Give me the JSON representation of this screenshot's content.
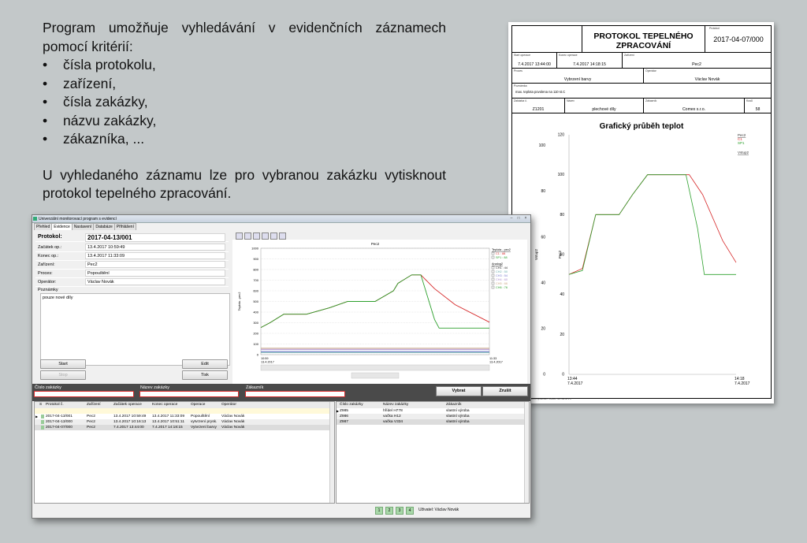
{
  "intro": {
    "para1": "Program umožňuje vyhledávání v evidenčních záznamech pomocí kritérií:",
    "bullets": [
      "čísla protokolu,",
      "zařízení,",
      "čísla zakázky,",
      "názvu zakázky,",
      "zákazníka, ..."
    ],
    "para2": "U vyhledaného záznamu lze pro vybranou zakázku vytisknout protokol tepelného zpracování."
  },
  "report": {
    "title": "PROTOKOL TEPELNÉHO ZPRACOVÁNÍ",
    "number_label": "Protokol",
    "number": "2017-04-07/000",
    "start_label": "Start operace",
    "start": "7.4.2017 13:44:00",
    "end_label": "Konec operace",
    "end": "7.4.2017 14:18:15",
    "device_label": "Zařízení",
    "device": "Pec2",
    "process_label": "Proces",
    "process": "Vybrzení barvy",
    "operator_label": "Operátor",
    "operator": "Václav Novák",
    "notes_label": "Poznámka",
    "notes": "max. teplota povolena na 110 st.C",
    "order_no_label": "Zakázka č.",
    "order_no": "Z1201",
    "order_name_label": "Název",
    "order_name": "plechové díly",
    "customer_label": "Zákazník",
    "customer": "Comex s.r.o.",
    "qty_label": "Kusů",
    "qty": "58",
    "chart_title": "Grafický průběh teplot",
    "footer": "Vytvořeno systémem ToBoxIT EV verze 1.0"
  },
  "app": {
    "window_title": "Univerzální monitorovací program s evidencí",
    "tabs": [
      "Přehled",
      "Evidence",
      "Nastavení",
      "Databáze",
      "Přihlášení"
    ],
    "fields": [
      {
        "label": "Protokol:",
        "value": "2017-04-13/001"
      },
      {
        "label": "Začátek op.:",
        "value": "13.4.2017 10:59:49"
      },
      {
        "label": "Konec op.:",
        "value": "13.4.2017 11:33:09"
      },
      {
        "label": "Zařízení:",
        "value": "Pec2"
      },
      {
        "label": "Proces:",
        "value": "Popouštění"
      },
      {
        "label": "Operátor:",
        "value": "Václav Novák"
      }
    ],
    "notes_label": "Poznámky",
    "notes": "pouze nové díly",
    "buttons": {
      "start": "Start",
      "stop": "Stop",
      "edit": "Edit",
      "print": "Tisk"
    },
    "chart_title": "Pec2",
    "search": {
      "order_no_label": "Číslo zakázky",
      "order_name_label": "Název zakázky",
      "customer_label": "Zákazník",
      "select_button": "Vybrat",
      "clear_button": "Zrušit"
    },
    "protocols": {
      "headers": [
        "S",
        "Protokol č.",
        "Zařízení",
        "Začátek operace",
        "Konec operace",
        "Operace",
        "Operátor"
      ],
      "rows": [
        [
          "",
          "2017-04-13/001",
          "Pec2",
          "13.4.2017 10:59:49",
          "13.4.2017 11:33:09",
          "Popouštění",
          "Václav Novák"
        ],
        [
          "",
          "2017-04-13/000",
          "Pec2",
          "13.4.2017 10:16:13",
          "13.4.2017 10:51:11",
          "vytvrzení prysk.",
          "Václav Novák"
        ],
        [
          "",
          "2017-04-07/000",
          "Pec2",
          "7.4.2017 13:44:00",
          "7.4.2017 14:18:15",
          "Vytvrzení barvy",
          "Václav Novák"
        ]
      ]
    },
    "orders": {
      "headers": [
        "Číslo zakázky",
        "Název zakázky",
        "Zákazník"
      ],
      "rows": [
        [
          "Z985",
          "hřídel H778",
          "vlastní výroba"
        ],
        [
          "Z986",
          "vačka H12",
          "vlastní výroba"
        ],
        [
          "Z987",
          "vačka V334",
          "vlastní výroba"
        ]
      ]
    },
    "pages": [
      "1",
      "2",
      "3",
      "4"
    ],
    "user": "Uživatel: Václav Novák"
  },
  "chart_data": [
    {
      "type": "line",
      "title": "Pec2",
      "xlabel": "",
      "ylabel": "Teplota - pec2",
      "x": [
        "10:59 13.4.2017",
        "11:33 13.4.2017"
      ],
      "ylim": [
        0,
        1000
      ],
      "yticks": [
        0,
        100,
        200,
        300,
        400,
        500,
        600,
        700,
        800,
        900,
        1000
      ],
      "x_tick_labels": [
        {
          "time": "10:59",
          "date": "13.4.2017"
        },
        {
          "time": "11:33",
          "date": "13.4.2017"
        }
      ],
      "legend": {
        "group1_title": "Teplota - pec2",
        "group1": [
          "C1 : 88",
          "SP1 : 88"
        ],
        "group2_title": "Analog2",
        "group2": [
          "CH1 : 44",
          "CH2 : 50",
          "CH3 : 54",
          "CH4 : 60",
          "CH5 : 66",
          "CH6 : 76"
        ]
      },
      "series": [
        {
          "name": "C1",
          "color": "#d62728",
          "points": [
            [
              0,
              255
            ],
            [
              0.04,
              300
            ],
            [
              0.1,
              380
            ],
            [
              0.2,
              380
            ],
            [
              0.3,
              440
            ],
            [
              0.38,
              500
            ],
            [
              0.5,
              500
            ],
            [
              0.58,
              600
            ],
            [
              0.6,
              670
            ],
            [
              0.66,
              750
            ],
            [
              0.7,
              750
            ],
            [
              0.76,
              620
            ],
            [
              0.85,
              470
            ],
            [
              1,
              305
            ]
          ]
        },
        {
          "name": "SP1",
          "color": "#2ca02c",
          "points": [
            [
              0,
              255
            ],
            [
              0.04,
              300
            ],
            [
              0.1,
              380
            ],
            [
              0.2,
              380
            ],
            [
              0.3,
              440
            ],
            [
              0.38,
              500
            ],
            [
              0.5,
              500
            ],
            [
              0.58,
              600
            ],
            [
              0.6,
              670
            ],
            [
              0.66,
              750
            ],
            [
              0.7,
              750
            ],
            [
              0.76,
              330
            ],
            [
              0.78,
              250
            ],
            [
              1,
              250
            ]
          ]
        }
      ],
      "flat_lines": [
        {
          "color": "#6aa",
          "value": 20
        },
        {
          "color": "#77c",
          "value": 30
        },
        {
          "color": "#a8c",
          "value": 50
        },
        {
          "color": "#ca8",
          "value": 60
        }
      ]
    },
    {
      "type": "line",
      "title": "Grafický průběh teplot",
      "ylabel": "Vstup2",
      "y2label": "Pec2",
      "ylim": [
        0,
        120
      ],
      "yticks_right": [
        0,
        20,
        40,
        60,
        80,
        100,
        120
      ],
      "yticks_left": [
        0,
        20,
        40,
        60,
        80,
        100
      ],
      "x_tick_labels": [
        {
          "time": "13:44",
          "date": "7.4.2017"
        },
        {
          "time": "14:18",
          "date": "7.4.2017"
        }
      ],
      "legend": [
        "Pec2",
        "C1",
        "SP1",
        "Vstup2"
      ],
      "series": [
        {
          "name": "C1",
          "color": "#d62728",
          "points": [
            [
              0,
              50
            ],
            [
              0.08,
              53
            ],
            [
              0.16,
              80
            ],
            [
              0.3,
              80
            ],
            [
              0.38,
              90
            ],
            [
              0.47,
              100
            ],
            [
              0.72,
              100
            ],
            [
              0.8,
              90
            ],
            [
              0.92,
              67
            ],
            [
              1,
              56
            ]
          ]
        },
        {
          "name": "SP1",
          "color": "#2ca02c",
          "points": [
            [
              0,
              50
            ],
            [
              0.08,
              52
            ],
            [
              0.16,
              80
            ],
            [
              0.3,
              80
            ],
            [
              0.38,
              90
            ],
            [
              0.47,
              100
            ],
            [
              0.7,
              100
            ],
            [
              0.77,
              73
            ],
            [
              0.81,
              50
            ],
            [
              1,
              50
            ]
          ]
        }
      ]
    }
  ]
}
